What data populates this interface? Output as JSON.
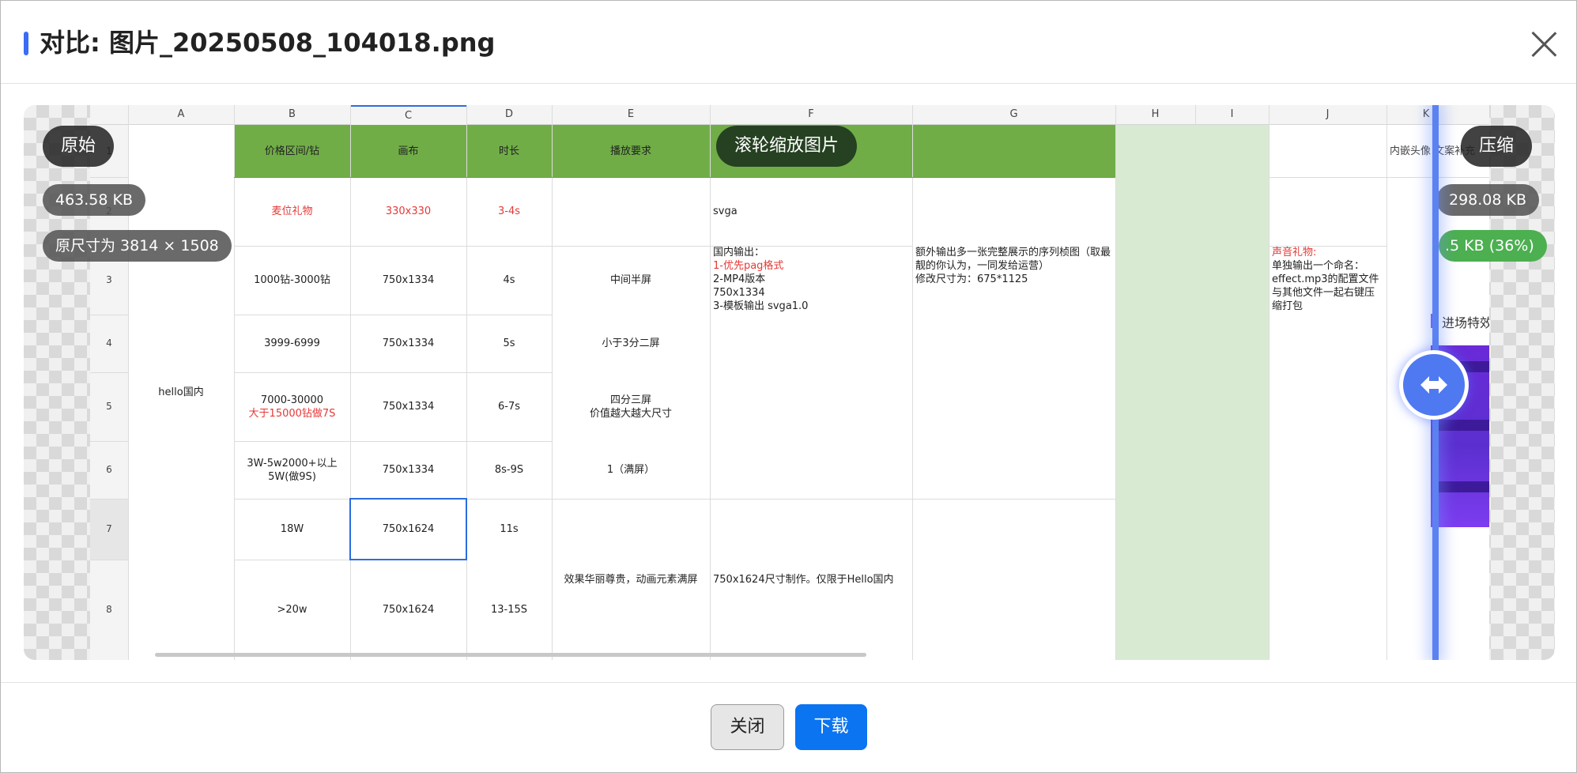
{
  "dialog": {
    "title": "对比: 图片_20250508_104018.png"
  },
  "labels": {
    "original": "原始",
    "original_size": "463.58 KB",
    "original_dims": "原尺寸为 3814 × 1508",
    "hint": "滚轮缩放图片",
    "compressed": "压缩",
    "compressed_size": "298.08 KB",
    "saving": ".5 KB (36%)"
  },
  "sheet": {
    "columns": [
      "A",
      "B",
      "C",
      "D",
      "E",
      "F",
      "G",
      "H",
      "I",
      "J",
      "K"
    ],
    "rows": [
      "1",
      "2",
      "3",
      "4",
      "5",
      "6",
      "7",
      "8"
    ],
    "header": {
      "b": "价格区间/钻",
      "c": "画布",
      "d": "时长",
      "e": "播放要求"
    },
    "a_merged": "hello国内",
    "r2": {
      "b": "麦位礼物",
      "c": "330x330",
      "d": "3-4s",
      "f": "svga"
    },
    "r3": {
      "b": "1000钻-3000钻",
      "c": "750x1334",
      "d": "4s",
      "e": "中间半屏"
    },
    "r4": {
      "b": "3999-6999",
      "c": "750x1334",
      "d": "5s",
      "e": "小于3分二屏"
    },
    "r5": {
      "b1": "7000-30000",
      "b2": "大于15000钻做7S",
      "c": "750x1334",
      "d": "6-7s",
      "e1": "四分三屏",
      "e2": "价值越大越大尺寸"
    },
    "r6": {
      "b1": "3W-5w2000+以上",
      "b2": "5W(做9S)",
      "c": "750x1334",
      "d": "8s-9S",
      "e": "1（满屏）"
    },
    "r7": {
      "b": "18W",
      "c": "750x1624",
      "d": "11s"
    },
    "r8": {
      "b": ">20w",
      "c": "750x1624",
      "d": "13-15S"
    },
    "e78": "效果华丽尊贵，动画元素满屏",
    "f36": {
      "l1": "国内输出：",
      "l2": "1-优先pag格式",
      "l3": "2-MP4版本",
      "l4": "750x1334",
      "l5": "3-模板输出 svga1.0"
    },
    "f78": "750x1624尺寸制作。仅限于Hello国内",
    "g_text": {
      "l1": "额外输出多一张完整展示的序列桢图（取最",
      "l2": "靓的你认为，一同发给运营）",
      "l3": "修改尺寸为：675*1125"
    },
    "j_text": {
      "l1": "声音礼物:",
      "l2": "单独输出一个命名：",
      "l3": "effect.mp3的配置文件",
      "l4": "与其他文件一起右键压",
      "l5": "缩打包"
    },
    "k1": "内嵌头像 文案补充",
    "k_title": "进场特效尺"
  },
  "footer": {
    "close": "关闭",
    "download": "下载"
  },
  "colors": {
    "accent": "#3b6cf6",
    "header_green": "#70ad47",
    "pale_green": "#d9ead3",
    "download_blue": "#0b74f0"
  }
}
